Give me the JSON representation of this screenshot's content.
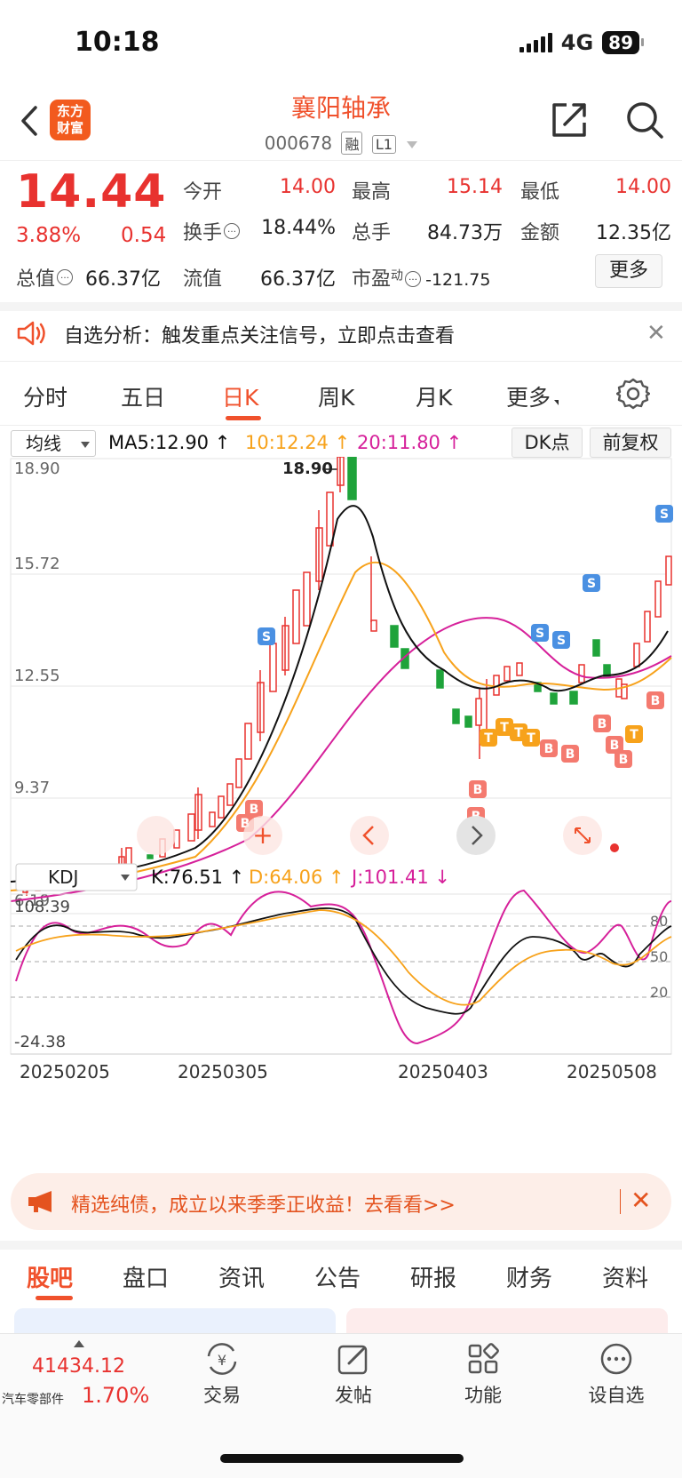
{
  "status": {
    "time": "10:18",
    "network": "4G",
    "battery": "89"
  },
  "header": {
    "logo_line1": "东方",
    "logo_line2": "财富",
    "stock_name": "襄阳轴承",
    "stock_code": "000678",
    "tag_margin": "融",
    "tag_level": "L1"
  },
  "quote": {
    "price": "14.44",
    "change_pct": "3.88%",
    "change": "0.54",
    "open_label": "今开",
    "open": "14.00",
    "high_label": "最高",
    "high": "15.14",
    "low_label": "最低",
    "low": "14.00",
    "turnover_label": "换手",
    "turnover": "18.44%",
    "volume_label": "总手",
    "volume": "84.73万",
    "amount_label": "金额",
    "amount": "12.35亿",
    "mcap_label": "总值",
    "mcap": "66.37亿",
    "float_label": "流值",
    "float_cap": "66.37亿",
    "pe_label": "市盈",
    "pe_sup": "动",
    "pe": "-121.75",
    "more": "更多"
  },
  "alert": {
    "text": "自选分析：触发重点关注信号，立即点击查看"
  },
  "period_tabs": [
    "分时",
    "五日",
    "日K",
    "周K",
    "月K",
    "更多"
  ],
  "ma": {
    "select": "均线",
    "ma5": "MA5:12.90 ↑",
    "ma10": "10:12.24 ↑",
    "ma20": "20:11.80 ↑",
    "dk": "DK点",
    "adjust": "前复权"
  },
  "kline_axis": {
    "y1": "18.90",
    "y2": "15.72",
    "y3": "12.55",
    "y4": "9.37",
    "y5": "6.19",
    "max_label": "18.90"
  },
  "kdj": {
    "select": "KDJ",
    "k": "K:76.51 ↑",
    "d": "D:64.06 ↑",
    "j": "J:101.41 ↓",
    "top": "108.39",
    "bottom": "-24.38",
    "l80": "80",
    "l50": "50",
    "l20": "20"
  },
  "dates": [
    "20250205",
    "20250305",
    "20250403",
    "20250508"
  ],
  "colors": {
    "up": "#e8322f",
    "down": "#1fa33a",
    "ma5": "#111111",
    "ma10": "#f7a21b",
    "ma20": "#d6209a",
    "accent": "#f0512c"
  },
  "banner": {
    "text": "精选纯债，成立以来季季正收益！去看看>>"
  },
  "bottom_tabs": [
    "股吧",
    "盘口",
    "资讯",
    "公告",
    "研报",
    "财务",
    "资料"
  ],
  "footer": {
    "index_value": "41434.12",
    "index_name": "汽车零部件",
    "index_pct": "1.70%",
    "trade": "交易",
    "post": "发帖",
    "function": "功能",
    "add": "设自选"
  }
}
